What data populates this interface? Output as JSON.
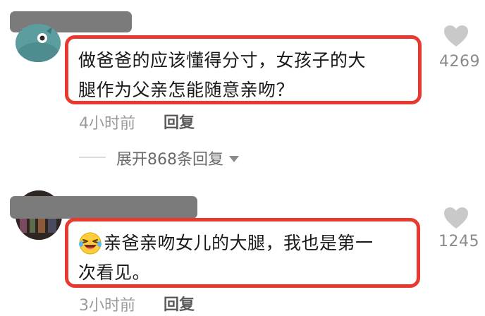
{
  "comments": [
    {
      "text": "做爸爸的应该懂得分寸，女孩子的大腿作为父亲怎能随意亲吻？",
      "line1": "做爸爸的应该懂得分寸，女孩子的大",
      "line2": "腿作为父亲怎能随意亲吻？",
      "time": "4小时前",
      "reply_label": "回复",
      "likes": "4269",
      "expand_label": "展开868条回复"
    },
    {
      "emoji": "laughing-face-emoji",
      "text": "亲爸亲吻女儿的大腿，我也是第一次看见。",
      "line1": "亲爸亲吻女儿的大腿，我也是第一",
      "line2": "次看见。",
      "time": "3小时前",
      "reply_label": "回复",
      "likes": "1245"
    }
  ],
  "colors": {
    "highlight_border": "#e8382f",
    "meta_text": "#9a9a9a",
    "redaction": "#7b7b7b"
  },
  "icons": {
    "like": "heart-icon",
    "expand": "triangle-down-icon"
  }
}
